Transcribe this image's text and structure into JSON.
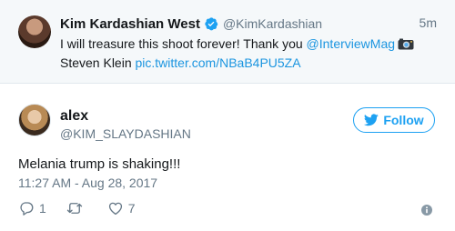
{
  "parent_tweet": {
    "author_name": "Kim Kardashian West",
    "author_handle": "@KimKardashian",
    "time_ago": "5m",
    "text_part1": "I will treasure this shoot forever! Thank you ",
    "mention": "@InterviewMag",
    "text_part2": "Steven Klein ",
    "link": "pic.twitter.com/NBaB4PU5ZA",
    "icons": [
      "verified-badge-icon",
      "camera-emoji-icon"
    ]
  },
  "tweet": {
    "author_name": "alex",
    "author_handle": "@KIM_SLAYDASHIAN",
    "follow_label": "Follow",
    "text": "Melania trump is shaking!!!",
    "timestamp": "11:27 AM - Aug 28, 2017",
    "reply_count": "1",
    "retweet_count": "",
    "like_count": "7",
    "icons": [
      "twitter-bird-icon",
      "reply-icon",
      "retweet-icon",
      "heart-icon",
      "info-icon"
    ]
  },
  "colors": {
    "accent": "#1da1f2",
    "link": "#1b95e0",
    "secondary_text": "#657786",
    "quoted_background": "#f5f8fa"
  }
}
